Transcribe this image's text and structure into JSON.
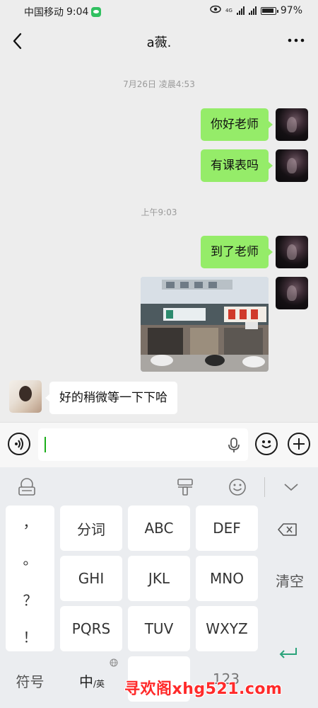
{
  "status_bar": {
    "carrier": "中国移动",
    "time": "9:04",
    "network": "4G",
    "battery": "97%"
  },
  "header": {
    "title": "a薇."
  },
  "messages": {
    "ts1": "7月26日 凌晨4:53",
    "m1": "你好老师",
    "m2": "有课表吗",
    "ts2": "上午9:03",
    "m3": "到了老师",
    "m5": "好的稍微等一下下哈"
  },
  "input": {
    "value": ""
  },
  "keyboard": {
    "punctuation": [
      "，",
      "。",
      "？",
      "！"
    ],
    "keys": [
      "分词",
      "ABC",
      "DEF",
      "GHI",
      "JKL",
      "MNO",
      "PQRS",
      "TUV",
      "WXYZ"
    ],
    "clear_label": "清空",
    "symbol_label": "符号",
    "lang_main": "中",
    "lang_sub": "/英",
    "num_label": "123"
  },
  "watermark": "寻欢阁xhg521.com",
  "colors": {
    "outgoing_bubble": "#95ec69",
    "incoming_bubble": "#ffffff",
    "background": "#ededed",
    "watermark": "#ff2a2a"
  }
}
